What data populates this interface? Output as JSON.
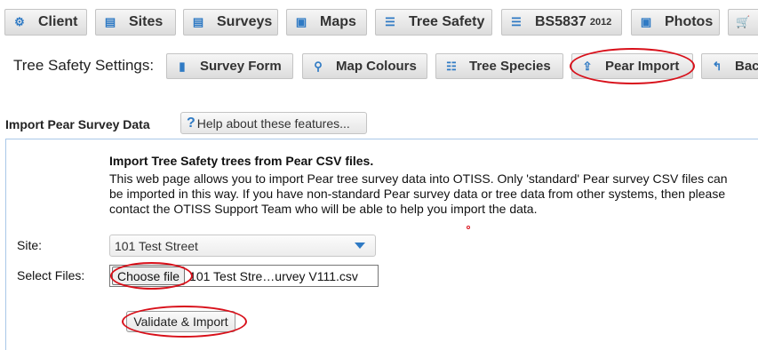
{
  "nav": {
    "items": [
      {
        "icon": "gear-icon",
        "glyph": "⚙",
        "label": "Client"
      },
      {
        "icon": "sites-icon",
        "glyph": "▤",
        "label": "Sites"
      },
      {
        "icon": "surveys-icon",
        "glyph": "▤",
        "label": "Surveys"
      },
      {
        "icon": "maps-icon",
        "glyph": "▣",
        "label": "Maps"
      },
      {
        "icon": "list-icon",
        "glyph": "☰",
        "label": "Tree Safety"
      },
      {
        "icon": "list-icon",
        "glyph": "☰",
        "label": "BS5837",
        "sub": "2012"
      },
      {
        "icon": "photos-icon",
        "glyph": "▣",
        "label": "Photos"
      },
      {
        "icon": "cart-icon",
        "glyph": "🛒",
        "label": ""
      }
    ]
  },
  "settings": {
    "label": "Tree Safety Settings:",
    "buttons": [
      {
        "icon": "survey-form-icon",
        "glyph": "▮",
        "label": "Survey Form"
      },
      {
        "icon": "map-marker-icon",
        "glyph": "⚲",
        "label": "Map Colours"
      },
      {
        "icon": "list-icon",
        "glyph": "☷",
        "label": "Tree Species"
      },
      {
        "icon": "upload-icon",
        "glyph": "⇪",
        "label": "Pear Import"
      },
      {
        "icon": "back-icon",
        "glyph": "↰",
        "label": "Back"
      }
    ]
  },
  "section": {
    "title": "Import Pear Survey Data",
    "help_label": "Help about these features..."
  },
  "import": {
    "heading": "Import Tree Safety trees from Pear CSV files.",
    "description_lines": [
      "This web page allows you to import Pear tree survey data into OTISS. Only 'standard' Pear survey CSV files can",
      "be imported in this way. If you have non-standard Pear survey data or tree data from other systems, then please",
      "contact the OTISS Support Team who will be able to help you import the data."
    ],
    "site_label": "Site:",
    "site_value": "101 Test Street",
    "files_label": "Select Files:",
    "choose_file_label": "Choose file",
    "file_name": "101 Test Stre…urvey V111.csv",
    "validate_label": "Validate & Import"
  },
  "colors": {
    "accent_blue": "#2f7ac4",
    "highlight_red": "#d8101a",
    "panel_border": "#a9c8e8"
  }
}
